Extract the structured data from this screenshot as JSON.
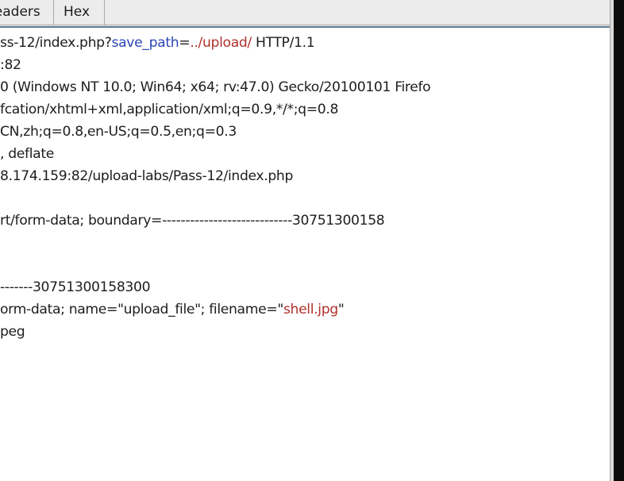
{
  "tabs": [
    {
      "label": "Headers"
    },
    {
      "label": "Hex"
    }
  ],
  "request": {
    "line0": {
      "prefix": "ss-12/index.php?",
      "param": "save_path",
      "eq": "=",
      "value": "../upload/",
      "suffix": " HTTP/1.1"
    },
    "line1": ":82",
    "line2": "0 (Windows NT 10.0; Win64; x64; rv:47.0) Gecko/20100101 Firefo",
    "line3": "fcation/xhtml+xml,application/xml;q=0.9,*/*;q=0.8",
    "line4": "CN,zh;q=0.8,en-US;q=0.5,en;q=0.3",
    "line5": ", deflate",
    "line6": "8.174.159:82/upload-labs/Pass-12/index.php",
    "line7": "",
    "line8": "rt/form-data; boundary=----------------------------30751300158",
    "line9": "",
    "line10": "",
    "line11": "-------30751300158300",
    "line12": {
      "prefix": "orm-data; name=\"upload_file\"; filename=\"",
      "value": "shell.jpg",
      "suffix": "\""
    },
    "line13": "peg"
  },
  "colors": {
    "param": "#2a46b3",
    "value": "#b0322d",
    "text": "#1d1d1d",
    "tab_bg": "#ececec",
    "selection_line": "#5d7b95"
  }
}
